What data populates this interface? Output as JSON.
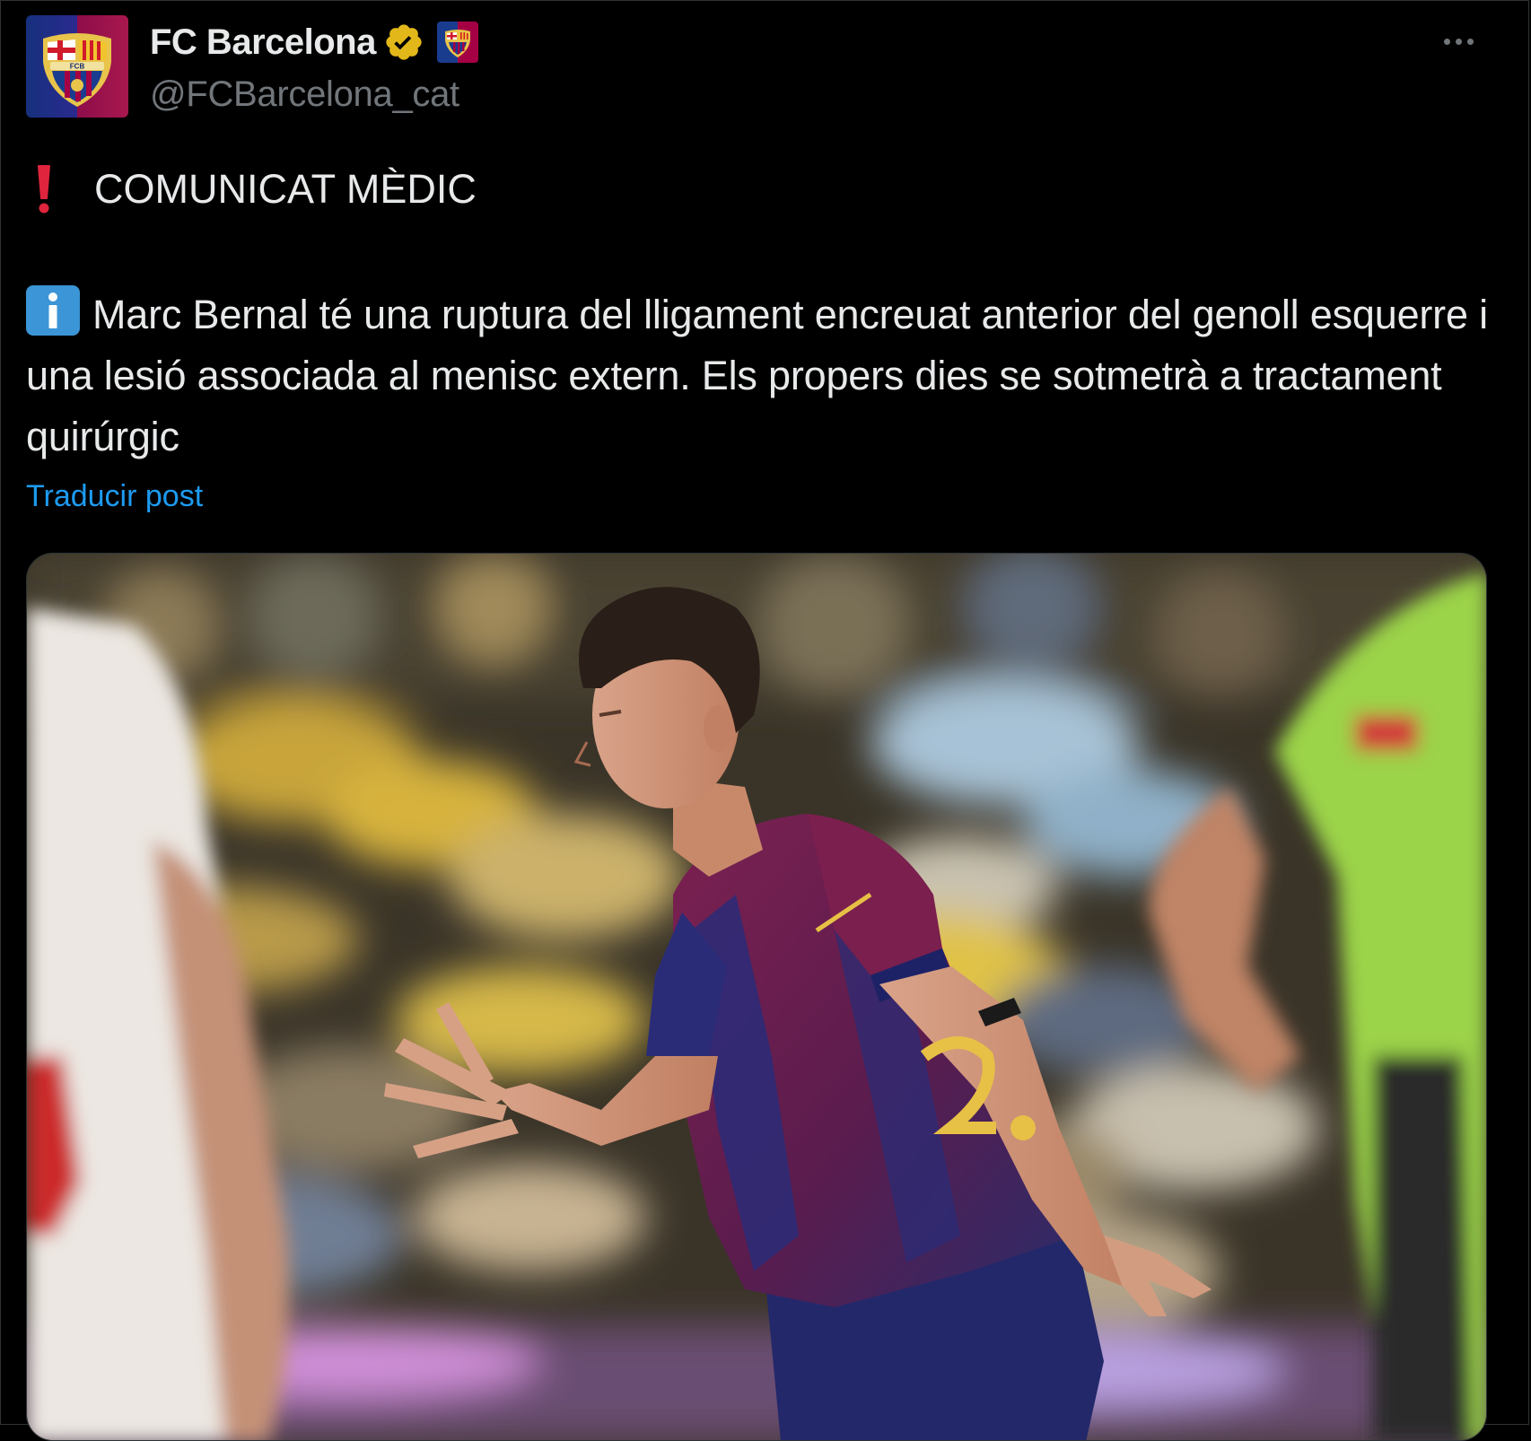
{
  "author": {
    "display_name": "FC Barcelona",
    "handle": "@FCBarcelona_cat",
    "verified": true,
    "avatar_icon": "fc-barcelona-crest",
    "affiliate_icon": "fc-barcelona-crest-badge"
  },
  "more_icon": "more-horizontal-icon",
  "post": {
    "headline": "COMUNICAT MÈDIC",
    "headline_icon": "red-exclamation-icon",
    "body_icon": "information-icon",
    "body": "Marc Bernal té una ruptura del lligament encreuat anterior del genoll esquerre i una lesió associada al menisc extern. Els propers dies se sotmetrà a tractament quirúrgic",
    "translate_link": "Traducir post"
  },
  "media": {
    "kind": "photo",
    "subject": "player in blaugrana kit"
  },
  "colors": {
    "background": "#000000",
    "text_primary": "#e7e9ea",
    "text_secondary": "#71767b",
    "link": "#1d9bf0",
    "verified_gold": "#e2b719",
    "barca_blue": "#1a3c8f",
    "barca_red": "#a50044"
  }
}
